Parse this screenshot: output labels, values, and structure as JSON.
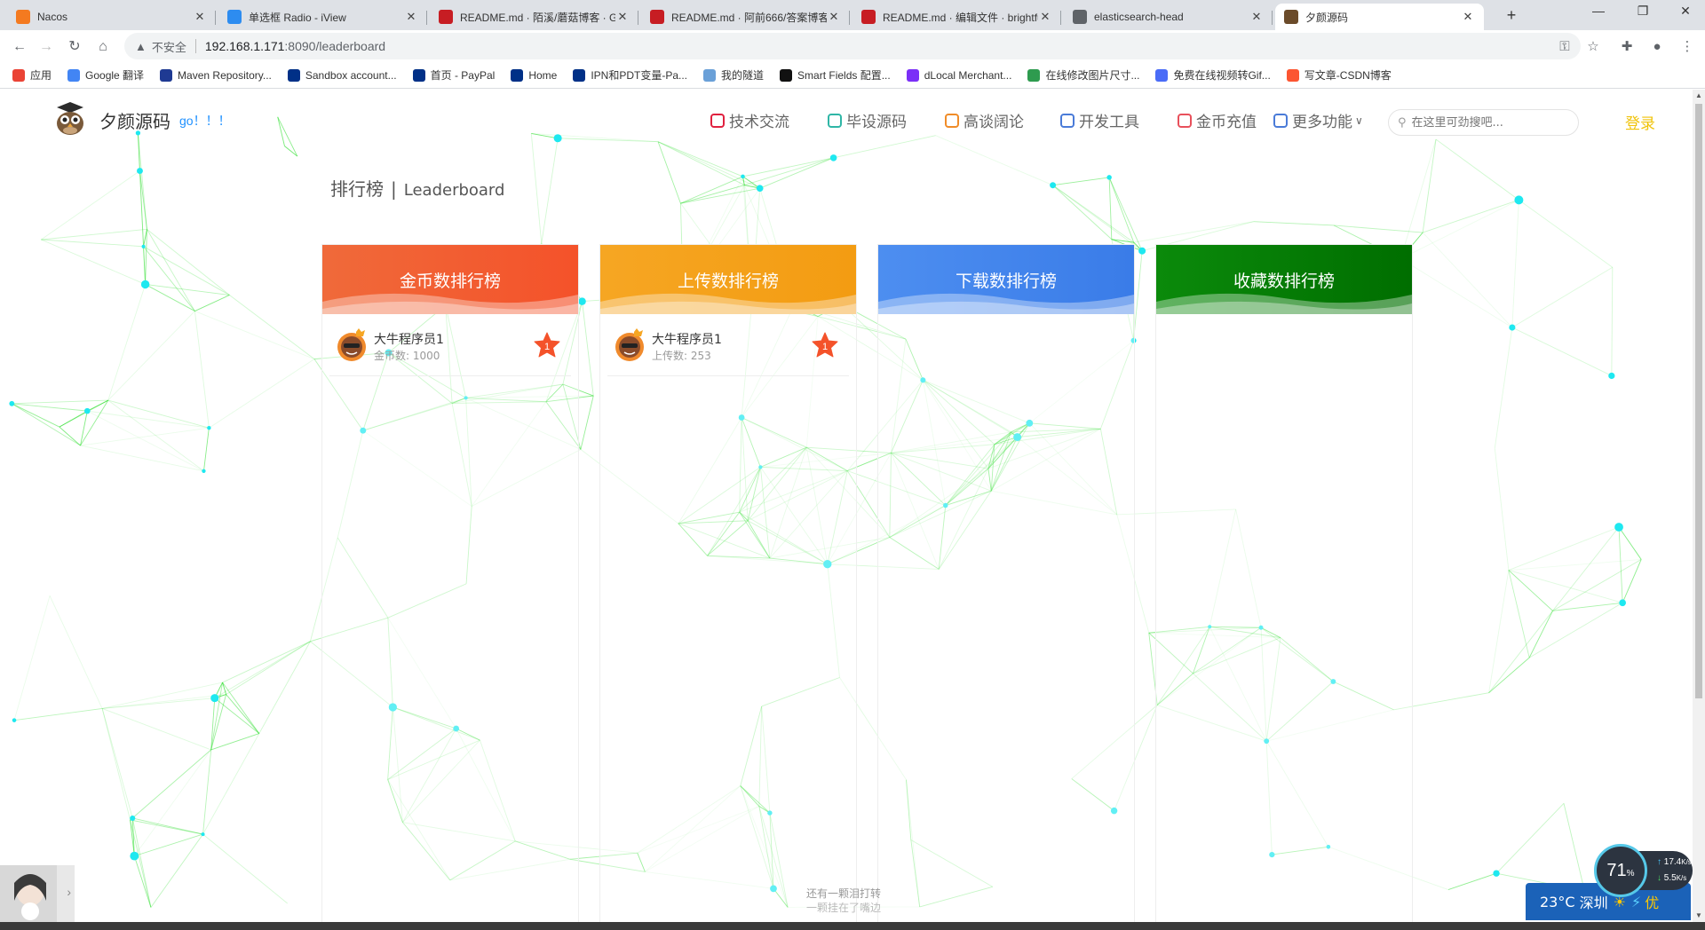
{
  "browser": {
    "tabs": [
      {
        "title": "Nacos",
        "icon": "nacos-icon",
        "color": "#f47a20"
      },
      {
        "title": "单选框 Radio - iView",
        "icon": "iview-icon",
        "color": "#2d8cf0"
      },
      {
        "title": "README.md · 陌溪/蘑菇博客 · Gi",
        "icon": "gitee-icon",
        "color": "#c71d23"
      },
      {
        "title": "README.md · 阿前666/答案博客",
        "icon": "gitee-icon",
        "color": "#c71d23"
      },
      {
        "title": "README.md · 编辑文件 · brightfu",
        "icon": "gitee-icon",
        "color": "#c71d23"
      },
      {
        "title": "elasticsearch-head",
        "icon": "globe-icon",
        "color": "#5f6368"
      },
      {
        "title": "夕颜源码",
        "icon": "owl-icon",
        "color": "#6b4b2a"
      }
    ],
    "new_tab": "+",
    "window_controls": {
      "minimize": "—",
      "maximize": "❐",
      "close": "✕"
    },
    "security_label": "不安全",
    "url_host": "192.168.1.171",
    "url_path": ":8090/leaderboard",
    "bookmarks": [
      {
        "label": "应用",
        "color": "#ea4335"
      },
      {
        "label": "Google 翻译",
        "color": "#4285f4"
      },
      {
        "label": "Maven Repository...",
        "color": "#1f3a93"
      },
      {
        "label": "Sandbox account...",
        "color": "#003087"
      },
      {
        "label": "首页 - PayPal",
        "color": "#003087"
      },
      {
        "label": "Home",
        "color": "#003087"
      },
      {
        "label": "IPN和PDT变量-Pa...",
        "color": "#003087"
      },
      {
        "label": "我的隧道",
        "color": "#6aa0d8"
      },
      {
        "label": "Smart Fields 配置...",
        "color": "#111111"
      },
      {
        "label": "dLocal Merchant...",
        "color": "#7b2ff7"
      },
      {
        "label": "在线修改图片尺寸...",
        "color": "#2e9b4f"
      },
      {
        "label": "免费在线视频转Gif...",
        "color": "#4a6cf7"
      },
      {
        "label": "写文章-CSDN博客",
        "color": "#fc5531"
      }
    ]
  },
  "site": {
    "brand": "夕颜源码",
    "slogan": "go！！！",
    "nav": [
      {
        "label": "技术交流",
        "icon": "tech-icon",
        "color": "#e0213f"
      },
      {
        "label": "毕设源码",
        "icon": "code-icon",
        "color": "#2fb6a6"
      },
      {
        "label": "高谈阔论",
        "icon": "talk-icon",
        "color": "#f08c28"
      },
      {
        "label": "开发工具",
        "icon": "tools-icon",
        "color": "#4a7bd8"
      },
      {
        "label": "金币充值",
        "icon": "wallet-icon",
        "color": "#e8505b"
      },
      {
        "label": "更多功能",
        "icon": "more-icon",
        "color": "#4a7bd8"
      }
    ],
    "search_placeholder": "在这里可劲搜吧...",
    "login": "登录"
  },
  "page": {
    "title_cn": "排行榜",
    "title_sep": "|",
    "title_en": "Leaderboard"
  },
  "boards": [
    {
      "title": "金币数排行榜",
      "color_from": "#f06a3a",
      "color_to": "#f4522a",
      "entries": [
        {
          "name": "大牛程序员1",
          "stat": "金币数: 1000",
          "rank": "1"
        }
      ]
    },
    {
      "title": "上传数排行榜",
      "color_from": "#f6a623",
      "color_to": "#f39c12",
      "entries": [
        {
          "name": "大牛程序员1",
          "stat": "上传数: 253",
          "rank": "1"
        }
      ]
    },
    {
      "title": "下载数排行榜",
      "color_from": "#4d8ef0",
      "color_to": "#3a7ce8",
      "entries": []
    },
    {
      "title": "收藏数排行榜",
      "color_from": "#0b8a0b",
      "color_to": "#006e00",
      "entries": []
    }
  ],
  "footer": {
    "line1": "还有一颗泪打转",
    "line2": "一颗挂在了嘴边"
  },
  "widgets": {
    "gauge_value": "71",
    "gauge_unit": "%",
    "upload_speed": "17.4",
    "upload_unit": "K/s",
    "download_speed": "5.5",
    "download_unit": "K/s",
    "temperature": "23°C",
    "city": "深圳",
    "air_quality": "优"
  }
}
